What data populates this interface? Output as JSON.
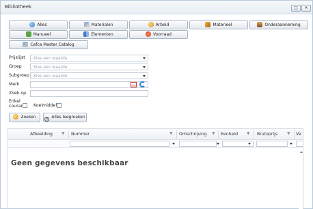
{
  "window": {
    "title": "Bibliotheek",
    "max_glyph": "□",
    "close_glyph": "✕"
  },
  "toolbar": {
    "row1": [
      {
        "label": "Alles",
        "icon": "globe-icon"
      },
      {
        "label": "Materialen",
        "icon": "materials-icon"
      },
      {
        "label": "Arbeid",
        "icon": "labor-icon"
      },
      {
        "label": "Materieel",
        "icon": "equipment-icon"
      },
      {
        "label": "Onderaanneming",
        "icon": "subcontract-icon"
      }
    ],
    "row2": [
      {
        "label": "Manueel",
        "icon": "manual-icon"
      },
      {
        "label": "Elementen",
        "icon": "elements-icon"
      },
      {
        "label": "Voorraad",
        "icon": "stock-icon"
      }
    ],
    "row3": [
      {
        "label": "Cafca Master Catalog",
        "icon": "catalog-icon"
      }
    ]
  },
  "form": {
    "prijslijst": {
      "label": "Prijslijst",
      "placeholder": "Kies een waarde"
    },
    "groep": {
      "label": "Groep",
      "placeholder": "Kies een waarde"
    },
    "subgroep": {
      "label": "Subgroep",
      "placeholder": "Kies een waarde"
    },
    "merk": {
      "label": "Merk",
      "value": ""
    },
    "zoek_op": {
      "label": "Zoek op",
      "value": ""
    },
    "enkel_courant": {
      "label": "Enkel courant"
    },
    "koelmiddel": {
      "label": "Koelmiddel"
    },
    "search_button": "Zoeken",
    "clear_button": "Alles leegmaken"
  },
  "grid": {
    "columns": [
      "Afbeelding",
      "Nummer",
      "Omschrijving",
      "Eenheid",
      "Brutoprijs",
      "Ve"
    ],
    "empty_message": "Geen gegevens beschikbaar"
  },
  "colors": {
    "border": "#b9c9d8",
    "button_border": "#a9b6c3",
    "placeholder": "#9aa4ad"
  }
}
